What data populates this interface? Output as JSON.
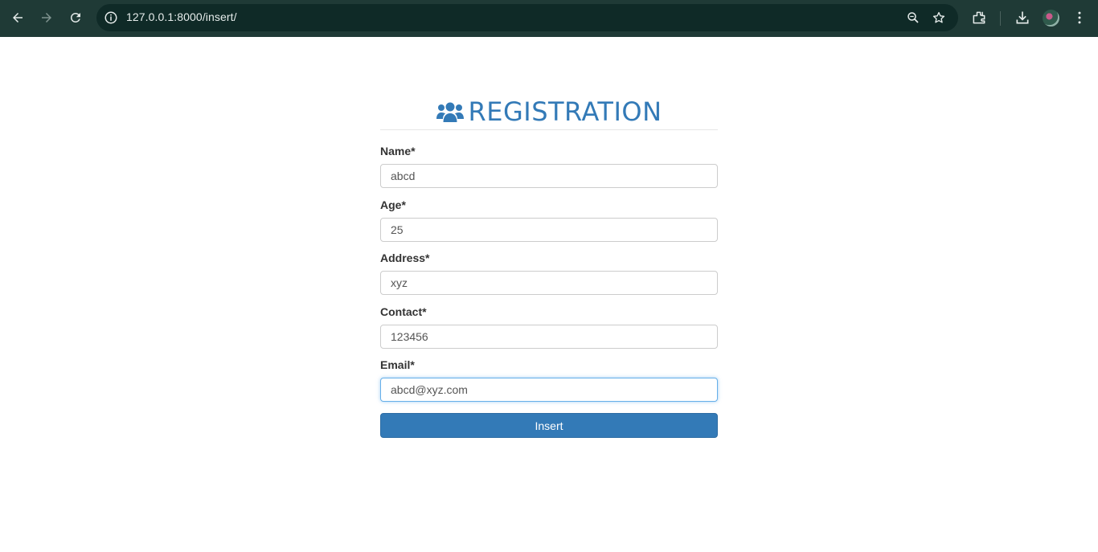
{
  "browser": {
    "url": "127.0.0.1:8000/insert/"
  },
  "form": {
    "title": "REGISTRATION",
    "fields": [
      {
        "label": "Name*",
        "value": "abcd"
      },
      {
        "label": "Age*",
        "value": "25"
      },
      {
        "label": "Address*",
        "value": "xyz"
      },
      {
        "label": "Contact*",
        "value": "123456"
      },
      {
        "label": "Email*",
        "value": "abcd@xyz.com"
      }
    ],
    "submit_label": "Insert"
  },
  "colors": {
    "chrome_bg": "#1f3a36",
    "accent": "#337ab7"
  }
}
